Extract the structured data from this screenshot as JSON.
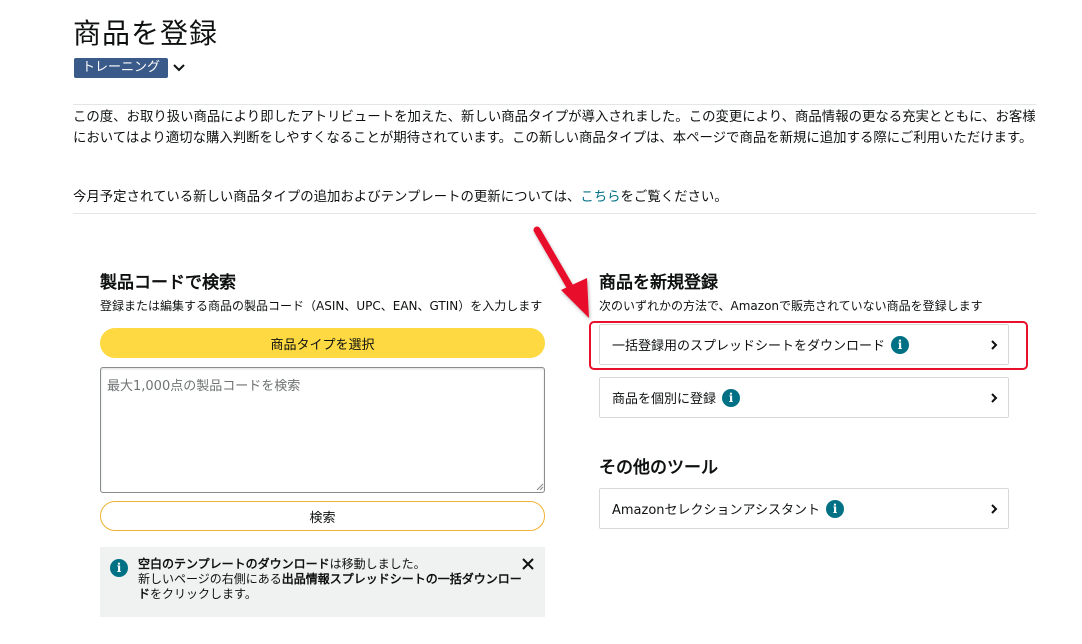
{
  "header": {
    "title": "商品を登録",
    "mode_badge": "トレーニング"
  },
  "notice": {
    "paragraph1": "この度、お取り扱い商品により即したアトリビュートを加えた、新しい商品タイプが導入されました。この変更により、商品情報の更なる充実とともに、お客様においてはより適切な購入判断をしやすくなることが期待されています。この新しい商品タイプは、本ページで商品を新規に追加する際にご利用いただけます。",
    "paragraph2_before": "今月予定されている新しい商品タイプの追加およびテンプレートの更新については、",
    "paragraph2_link": "こちら",
    "paragraph2_after": "をご覧ください。"
  },
  "search": {
    "title": "製品コードで検索",
    "subtitle": "登録または編集する商品の製品コード（ASIN、UPC、EAN、GTIN）を入力します",
    "select_type_button": "商品タイプを選択",
    "placeholder": "最大1,000点の製品コードを検索",
    "search_button": "検索"
  },
  "alert": {
    "line1_bold": "空白のテンプレートのダウンロード",
    "line1_rest": "は移動しました。",
    "line2_before": "新しいページの右側にある",
    "line2_bold": "出品情報スプレッドシートの一括ダウンロード",
    "line2_after": "をクリックします。"
  },
  "new_listing": {
    "title": "商品を新規登録",
    "subtitle": "次のいずれかの方法で、Amazonで販売されていない商品を登録します",
    "options": [
      {
        "label": "一括登録用のスプレッドシートをダウンロード"
      },
      {
        "label": "商品を個別に登録"
      }
    ]
  },
  "other_tools": {
    "title": "その他のツール",
    "options": [
      {
        "label": "Amazonセレクションアシスタント"
      }
    ]
  },
  "colors": {
    "accent_yellow": "#fed941",
    "link_teal": "#007185",
    "highlight_red": "#e8102a",
    "badge_blue": "#3a5a8a"
  }
}
